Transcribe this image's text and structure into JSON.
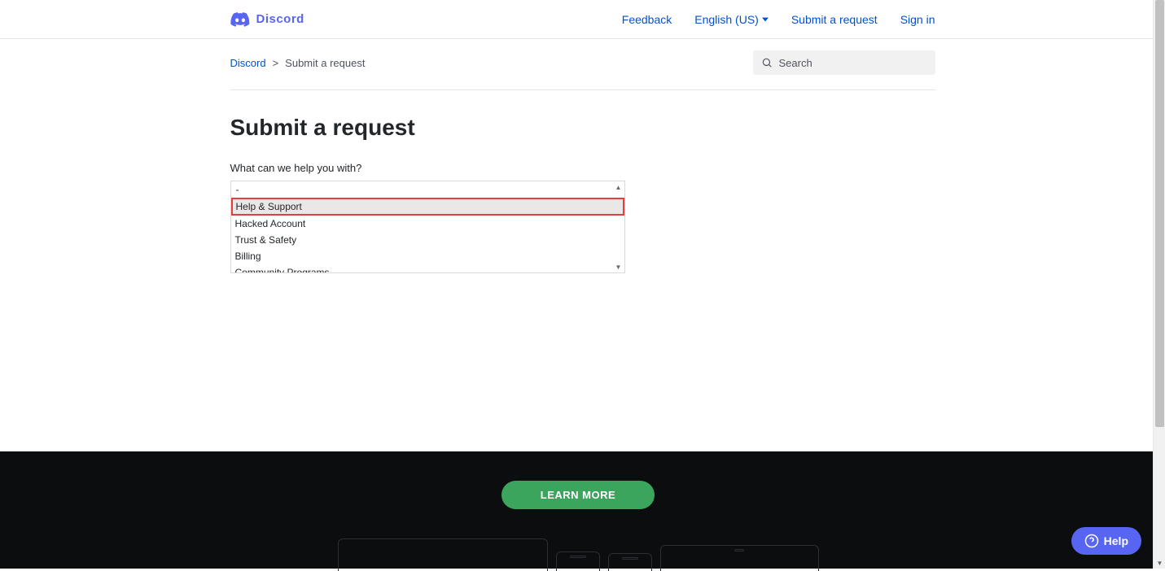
{
  "header": {
    "logo_text": "Discord",
    "nav": {
      "feedback": "Feedback",
      "language": "English (US)",
      "submit": "Submit a request",
      "signin": "Sign in"
    }
  },
  "breadcrumb": {
    "root": "Discord",
    "separator": ">",
    "current": "Submit a request"
  },
  "search": {
    "placeholder": "Search"
  },
  "main": {
    "title": "Submit a request",
    "form_label": "What can we help you with?",
    "selected_value": "-",
    "options": [
      "Help & Support",
      "Hacked Account",
      "Trust & Safety",
      "Billing",
      "Community Programs"
    ],
    "highlighted_index": 0
  },
  "footer": {
    "learn_more": "LEARN MORE"
  },
  "help_widget": {
    "label": "Help"
  }
}
